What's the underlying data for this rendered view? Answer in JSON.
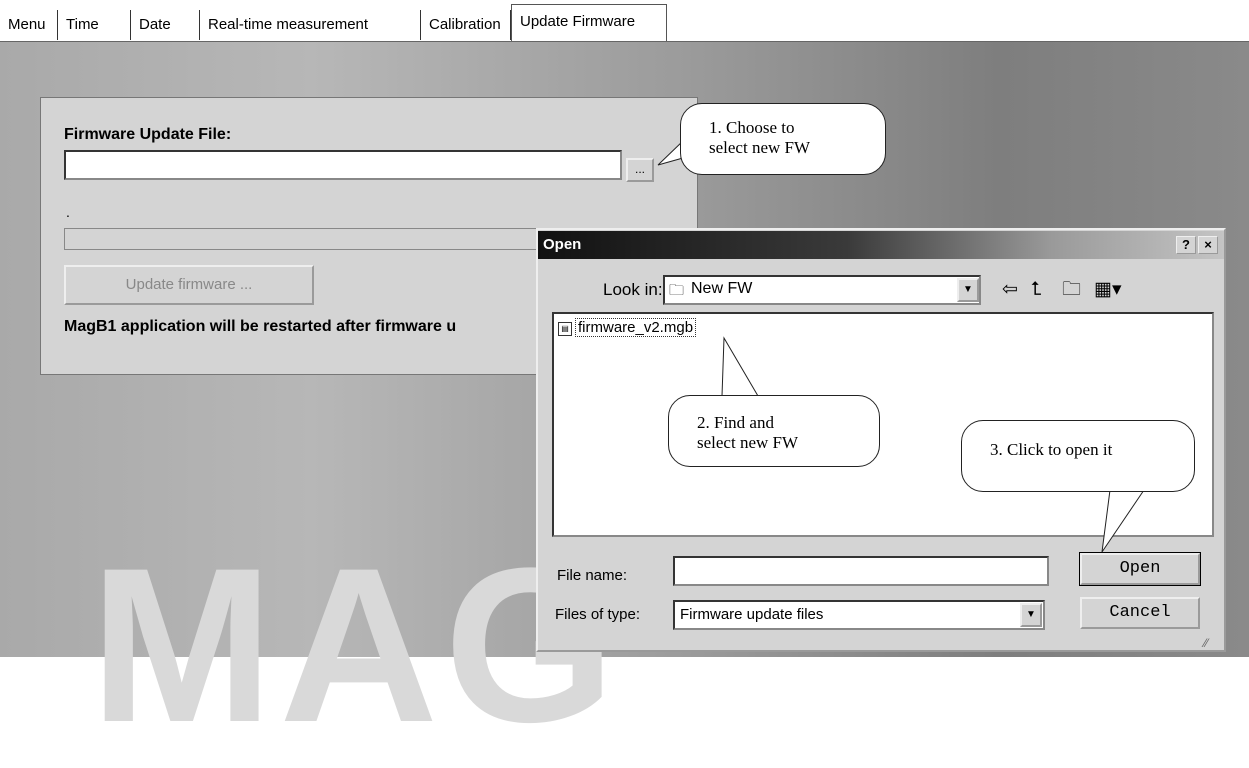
{
  "tabs": [
    {
      "label": "Menu"
    },
    {
      "label": "Time"
    },
    {
      "label": "Date"
    },
    {
      "label": "Real-time measurement"
    },
    {
      "label": "Calibration"
    },
    {
      "label": "Update Firmware",
      "active": true
    }
  ],
  "firmware": {
    "file_label": "Firmware Update File:",
    "file_value": "",
    "browse_label": "...",
    "status_text": ".",
    "update_button": "Update firmware ...",
    "note": "MagB1 application will be restarted after firmware u"
  },
  "background_text": "MAG",
  "dialog": {
    "title": "Open",
    "help_button": "?",
    "close_button": "×",
    "look_in_label": "Look in:",
    "look_in_value": "New FW",
    "files": [
      {
        "name": "firmware_v2.mgb"
      }
    ],
    "file_name_label": "File name:",
    "file_name_value": "",
    "files_of_type_label": "Files of type:",
    "files_of_type_value": "Firmware update files",
    "open_button": "Open",
    "cancel_button": "Cancel",
    "icons": [
      "folder-icon",
      "back-arrow-icon",
      "up-folder-icon",
      "new-folder-icon",
      "view-menu-icon"
    ]
  },
  "callouts": {
    "step1": [
      "1. Choose to",
      "select new FW"
    ],
    "step2": [
      "2. Find and",
      "select new FW"
    ],
    "step3": "3. Click to open it"
  }
}
